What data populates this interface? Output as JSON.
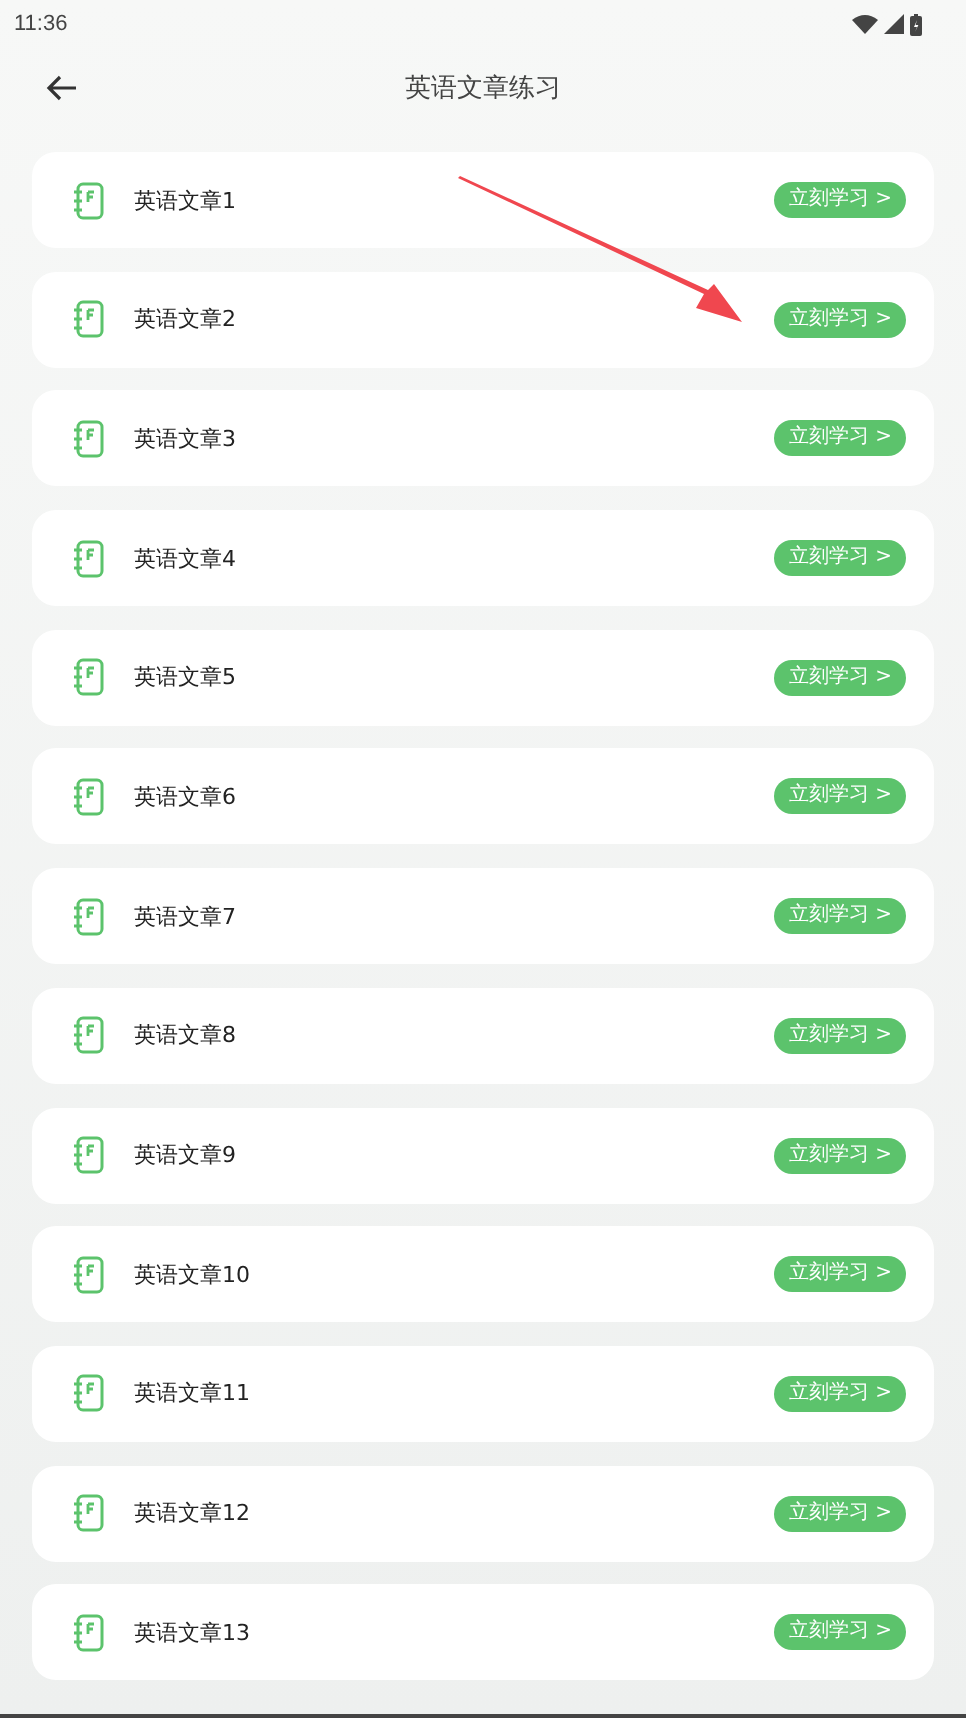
{
  "status_bar": {
    "time": "11:36"
  },
  "header": {
    "title": "英语文章练习"
  },
  "articles": [
    {
      "title": "英语文章1",
      "button": "立刻学习 >"
    },
    {
      "title": "英语文章2",
      "button": "立刻学习 >"
    },
    {
      "title": "英语文章3",
      "button": "立刻学习 >"
    },
    {
      "title": "英语文章4",
      "button": "立刻学习 >"
    },
    {
      "title": "英语文章5",
      "button": "立刻学习 >"
    },
    {
      "title": "英语文章6",
      "button": "立刻学习 >"
    },
    {
      "title": "英语文章7",
      "button": "立刻学习 >"
    },
    {
      "title": "英语文章8",
      "button": "立刻学习 >"
    },
    {
      "title": "英语文章9",
      "button": "立刻学习 >"
    },
    {
      "title": "英语文章10",
      "button": "立刻学习 >"
    },
    {
      "title": "英语文章11",
      "button": "立刻学习 >"
    },
    {
      "title": "英语文章12",
      "button": "立刻学习 >"
    },
    {
      "title": "英语文章13",
      "button": "立刻学习 >"
    }
  ]
}
